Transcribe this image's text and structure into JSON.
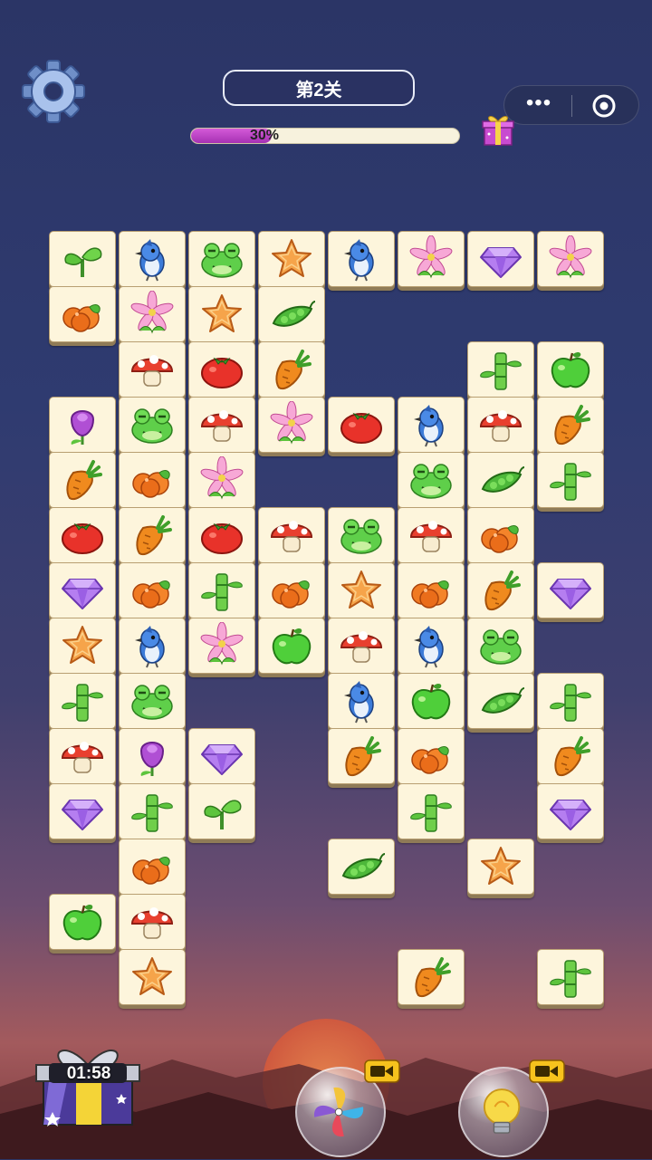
{
  "level": {
    "title": "第2关"
  },
  "progress": {
    "label": "30%",
    "value": 0.3
  },
  "timer": {
    "label": "01:58"
  },
  "colors": {
    "accent": "#b13fbf",
    "tile_face": "#fdf5dc",
    "tile_edge": "#8f7b57",
    "pill_border": "#e8ecf8"
  },
  "icons": {
    "settings": "gear-icon",
    "more": "more-dots-icon",
    "close": "target-circle-icon",
    "gift": "gift-box-icon",
    "shuffle": "pinwheel-icon",
    "hint": "light-bulb-icon",
    "video": "video-camera-icon"
  },
  "tiles": [
    {
      "col": 0,
      "row": 0,
      "type": "sprout"
    },
    {
      "col": 1,
      "row": 0,
      "type": "bluebird"
    },
    {
      "col": 2,
      "row": 0,
      "type": "frog"
    },
    {
      "col": 3,
      "row": 0,
      "type": "star"
    },
    {
      "col": 4,
      "row": 0,
      "type": "bluebird"
    },
    {
      "col": 5,
      "row": 0,
      "type": "lily"
    },
    {
      "col": 6,
      "row": 0,
      "type": "gem"
    },
    {
      "col": 7,
      "row": 0,
      "type": "lily"
    },
    {
      "col": 0,
      "row": 1,
      "type": "orange"
    },
    {
      "col": 1,
      "row": 1,
      "type": "lily"
    },
    {
      "col": 2,
      "row": 1,
      "type": "star"
    },
    {
      "col": 3,
      "row": 1,
      "type": "peas"
    },
    {
      "col": 1,
      "row": 2,
      "type": "mushroom"
    },
    {
      "col": 2,
      "row": 2,
      "type": "tomato"
    },
    {
      "col": 3,
      "row": 2,
      "type": "carrot"
    },
    {
      "col": 6,
      "row": 2,
      "type": "bamboo"
    },
    {
      "col": 7,
      "row": 2,
      "type": "apple"
    },
    {
      "col": 0,
      "row": 3,
      "type": "rose"
    },
    {
      "col": 1,
      "row": 3,
      "type": "frog"
    },
    {
      "col": 2,
      "row": 3,
      "type": "mushroom"
    },
    {
      "col": 3,
      "row": 3,
      "type": "lily"
    },
    {
      "col": 4,
      "row": 3,
      "type": "tomato"
    },
    {
      "col": 5,
      "row": 3,
      "type": "bluebird"
    },
    {
      "col": 6,
      "row": 3,
      "type": "mushroom"
    },
    {
      "col": 7,
      "row": 3,
      "type": "carrot"
    },
    {
      "col": 0,
      "row": 4,
      "type": "carrot"
    },
    {
      "col": 1,
      "row": 4,
      "type": "orange"
    },
    {
      "col": 2,
      "row": 4,
      "type": "lily"
    },
    {
      "col": 5,
      "row": 4,
      "type": "frog"
    },
    {
      "col": 6,
      "row": 4,
      "type": "peas"
    },
    {
      "col": 7,
      "row": 4,
      "type": "bamboo"
    },
    {
      "col": 0,
      "row": 5,
      "type": "tomato"
    },
    {
      "col": 1,
      "row": 5,
      "type": "carrot"
    },
    {
      "col": 2,
      "row": 5,
      "type": "tomato"
    },
    {
      "col": 3,
      "row": 5,
      "type": "mushroom"
    },
    {
      "col": 4,
      "row": 5,
      "type": "frog"
    },
    {
      "col": 5,
      "row": 5,
      "type": "mushroom"
    },
    {
      "col": 6,
      "row": 5,
      "type": "orange"
    },
    {
      "col": 0,
      "row": 6,
      "type": "gem"
    },
    {
      "col": 1,
      "row": 6,
      "type": "orange"
    },
    {
      "col": 2,
      "row": 6,
      "type": "bamboo"
    },
    {
      "col": 3,
      "row": 6,
      "type": "orange"
    },
    {
      "col": 4,
      "row": 6,
      "type": "star"
    },
    {
      "col": 5,
      "row": 6,
      "type": "orange"
    },
    {
      "col": 6,
      "row": 6,
      "type": "carrot"
    },
    {
      "col": 7,
      "row": 6,
      "type": "gem"
    },
    {
      "col": 0,
      "row": 7,
      "type": "star"
    },
    {
      "col": 1,
      "row": 7,
      "type": "bluebird"
    },
    {
      "col": 2,
      "row": 7,
      "type": "lily"
    },
    {
      "col": 3,
      "row": 7,
      "type": "apple"
    },
    {
      "col": 4,
      "row": 7,
      "type": "mushroom"
    },
    {
      "col": 5,
      "row": 7,
      "type": "bluebird"
    },
    {
      "col": 6,
      "row": 7,
      "type": "frog"
    },
    {
      "col": 0,
      "row": 8,
      "type": "bamboo"
    },
    {
      "col": 1,
      "row": 8,
      "type": "frog"
    },
    {
      "col": 4,
      "row": 8,
      "type": "bluebird"
    },
    {
      "col": 5,
      "row": 8,
      "type": "apple"
    },
    {
      "col": 6,
      "row": 8,
      "type": "peas"
    },
    {
      "col": 7,
      "row": 8,
      "type": "bamboo"
    },
    {
      "col": 0,
      "row": 9,
      "type": "mushroom"
    },
    {
      "col": 1,
      "row": 9,
      "type": "rose"
    },
    {
      "col": 2,
      "row": 9,
      "type": "gem"
    },
    {
      "col": 4,
      "row": 9,
      "type": "carrot"
    },
    {
      "col": 5,
      "row": 9,
      "type": "orange"
    },
    {
      "col": 7,
      "row": 9,
      "type": "carrot"
    },
    {
      "col": 0,
      "row": 10,
      "type": "gem"
    },
    {
      "col": 1,
      "row": 10,
      "type": "bamboo"
    },
    {
      "col": 2,
      "row": 10,
      "type": "sprout"
    },
    {
      "col": 5,
      "row": 10,
      "type": "bamboo"
    },
    {
      "col": 7,
      "row": 10,
      "type": "gem"
    },
    {
      "col": 1,
      "row": 11,
      "type": "orange"
    },
    {
      "col": 4,
      "row": 11,
      "type": "peas"
    },
    {
      "col": 6,
      "row": 11,
      "type": "star"
    },
    {
      "col": 0,
      "row": 12,
      "type": "apple"
    },
    {
      "col": 1,
      "row": 12,
      "type": "mushroom"
    },
    {
      "col": 1,
      "row": 13,
      "type": "star"
    },
    {
      "col": 5,
      "row": 13,
      "type": "carrot"
    },
    {
      "col": 7,
      "row": 13,
      "type": "bamboo"
    }
  ]
}
